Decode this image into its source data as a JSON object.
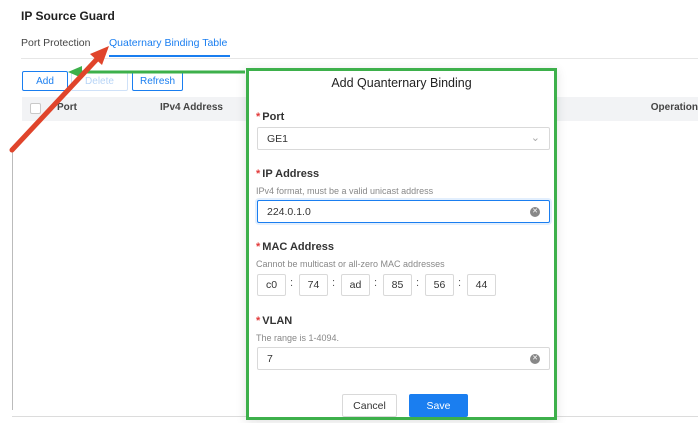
{
  "page": {
    "title": "IP Source Guard"
  },
  "tabs": [
    {
      "label": "Port Protection"
    },
    {
      "label": "Quaternary Binding Table"
    }
  ],
  "toolbar": {
    "add": "Add",
    "delete": "Delete",
    "refresh": "Refresh"
  },
  "table": {
    "columns": {
      "port": "Port",
      "ipv4": "IPv4 Address",
      "operation": "Operation"
    }
  },
  "modal": {
    "title": "Add Quanternary Binding",
    "required_mark": "*",
    "port": {
      "label": "Port",
      "value": "GE1"
    },
    "ip": {
      "label": "IP Address",
      "hint": "IPv4 format, must be a valid unicast address",
      "value": "224.0.1.0"
    },
    "mac": {
      "label": "MAC Address",
      "hint": "Cannot be multicast or all-zero MAC addresses",
      "octets": [
        "c0",
        "74",
        "ad",
        "85",
        "56",
        "44"
      ],
      "separator": ":"
    },
    "vlan": {
      "label": "VLAN",
      "hint": "The range is 1-4094.",
      "value": "7"
    },
    "cancel": "Cancel",
    "save": "Save"
  },
  "icons": {
    "dropdown": "chevron-down-icon",
    "clear": "clear-icon"
  },
  "colors": {
    "accent": "#1a7ef0",
    "annotation_green": "#3db04b",
    "annotation_red": "#e0442b",
    "required": "#e23a3a"
  }
}
